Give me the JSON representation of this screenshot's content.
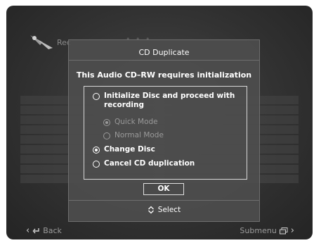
{
  "background": {
    "title_fragment": "Rec",
    "dots": "• • •"
  },
  "dialog": {
    "title": "CD Duplicate",
    "message": "This Audio CD–RW requires initialization",
    "options": [
      {
        "label_line1": "Initialize Disc and proceed with",
        "label_line2": "recording",
        "selected": false,
        "enabled": true
      },
      {
        "label": "Quick Mode",
        "selected": true,
        "enabled": false
      },
      {
        "label": "Normal Mode",
        "selected": false,
        "enabled": false
      },
      {
        "label": "Change Disc",
        "selected": true,
        "enabled": true
      },
      {
        "label": "Cancel CD duplication",
        "selected": false,
        "enabled": true
      }
    ],
    "ok_label": "OK",
    "select_hint": "Select"
  },
  "bottom_bar": {
    "back_label": "Back",
    "submenu_label": "Submenu"
  },
  "colors": {
    "screen_bg": "#323232",
    "dialog_bg": "#4e4e4e",
    "text": "#ffffff",
    "disabled_text": "#9a9a9a"
  }
}
